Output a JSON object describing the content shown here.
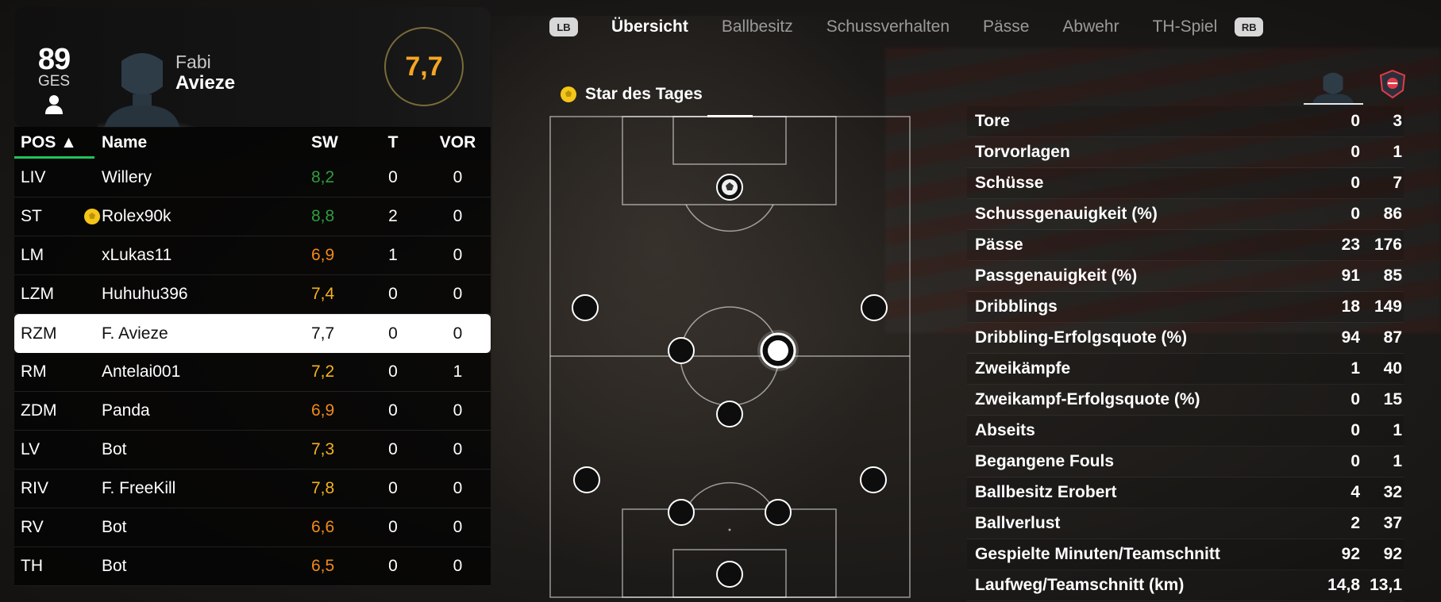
{
  "player": {
    "overall": "89",
    "overall_label": "GES",
    "first_name": "Fabi",
    "last_name": "Avieze",
    "match_rating": "7,7"
  },
  "table": {
    "headers": {
      "pos": "POS ▲",
      "name": "Name",
      "sw": "SW",
      "t": "T",
      "vor": "VOR"
    },
    "rows": [
      {
        "pos": "LIV",
        "name": "Willery",
        "sw": "8,2",
        "t": "0",
        "vor": "0",
        "rating_color": "#2e9e3b",
        "star": false,
        "selected": false
      },
      {
        "pos": "ST",
        "name": "Rolex90k",
        "sw": "8,8",
        "t": "2",
        "vor": "0",
        "rating_color": "#2e9e3b",
        "star": true,
        "selected": false
      },
      {
        "pos": "LM",
        "name": "xLukas11",
        "sw": "6,9",
        "t": "1",
        "vor": "0",
        "rating_color": "#f08a1a",
        "star": false,
        "selected": false
      },
      {
        "pos": "LZM",
        "name": "Huhuhu396",
        "sw": "7,4",
        "t": "0",
        "vor": "0",
        "rating_color": "#f5b21c",
        "star": false,
        "selected": false
      },
      {
        "pos": "RZM",
        "name": "F. Avieze",
        "sw": "7,7",
        "t": "0",
        "vor": "0",
        "rating_color": "#111111",
        "star": false,
        "selected": true
      },
      {
        "pos": "RM",
        "name": "Antelai001",
        "sw": "7,2",
        "t": "0",
        "vor": "1",
        "rating_color": "#f5b21c",
        "star": false,
        "selected": false
      },
      {
        "pos": "ZDM",
        "name": "Panda",
        "sw": "6,9",
        "t": "0",
        "vor": "0",
        "rating_color": "#f08a1a",
        "star": false,
        "selected": false
      },
      {
        "pos": "LV",
        "name": "Bot",
        "sw": "7,3",
        "t": "0",
        "vor": "0",
        "rating_color": "#f5b21c",
        "star": false,
        "selected": false
      },
      {
        "pos": "RIV",
        "name": "F. FreeKill",
        "sw": "7,8",
        "t": "0",
        "vor": "0",
        "rating_color": "#f5b21c",
        "star": false,
        "selected": false
      },
      {
        "pos": "RV",
        "name": "Bot",
        "sw": "6,6",
        "t": "0",
        "vor": "0",
        "rating_color": "#f08a1a",
        "star": false,
        "selected": false
      },
      {
        "pos": "TH",
        "name": "Bot",
        "sw": "6,5",
        "t": "0",
        "vor": "0",
        "rating_color": "#f08a1a",
        "star": false,
        "selected": false
      }
    ]
  },
  "tabs": {
    "left_button": "LB",
    "right_button": "RB",
    "items": [
      "Übersicht",
      "Ballbesitz",
      "Schussverhalten",
      "Pässe",
      "Abwehr",
      "TH-Spiel"
    ],
    "active_index": 0
  },
  "star_of_day": {
    "label": "Star des Tages"
  },
  "stats": {
    "rows": [
      {
        "label": "Tore",
        "a": "0",
        "b": "3"
      },
      {
        "label": "Torvorlagen",
        "a": "0",
        "b": "1"
      },
      {
        "label": "Schüsse",
        "a": "0",
        "b": "7"
      },
      {
        "label": "Schussgenauigkeit (%)",
        "a": "0",
        "b": "86"
      },
      {
        "label": "Pässe",
        "a": "23",
        "b": "176"
      },
      {
        "label": "Passgenauigkeit (%)",
        "a": "91",
        "b": "85"
      },
      {
        "label": "Dribblings",
        "a": "18",
        "b": "149"
      },
      {
        "label": "Dribbling-Erfolgsquote (%)",
        "a": "94",
        "b": "87"
      },
      {
        "label": "Zweikämpfe",
        "a": "1",
        "b": "40"
      },
      {
        "label": "Zweikampf-Erfolgsquote (%)",
        "a": "0",
        "b": "15"
      },
      {
        "label": "Abseits",
        "a": "0",
        "b": "1"
      },
      {
        "label": "Begangene Fouls",
        "a": "0",
        "b": "1"
      },
      {
        "label": "Ballbesitz Erobert",
        "a": "4",
        "b": "32"
      },
      {
        "label": "Ballverlust",
        "a": "2",
        "b": "37"
      },
      {
        "label": "Gespielte Minuten/Teamschnitt",
        "a": "92",
        "b": "92"
      },
      {
        "label": "Laufweg/Teamschnitt (km)",
        "a": "14,8",
        "b": "13,1"
      }
    ]
  },
  "colors": {
    "accent_green": "#21c25e",
    "rating_orange": "#f5a623",
    "star_yellow": "#f5c518"
  }
}
